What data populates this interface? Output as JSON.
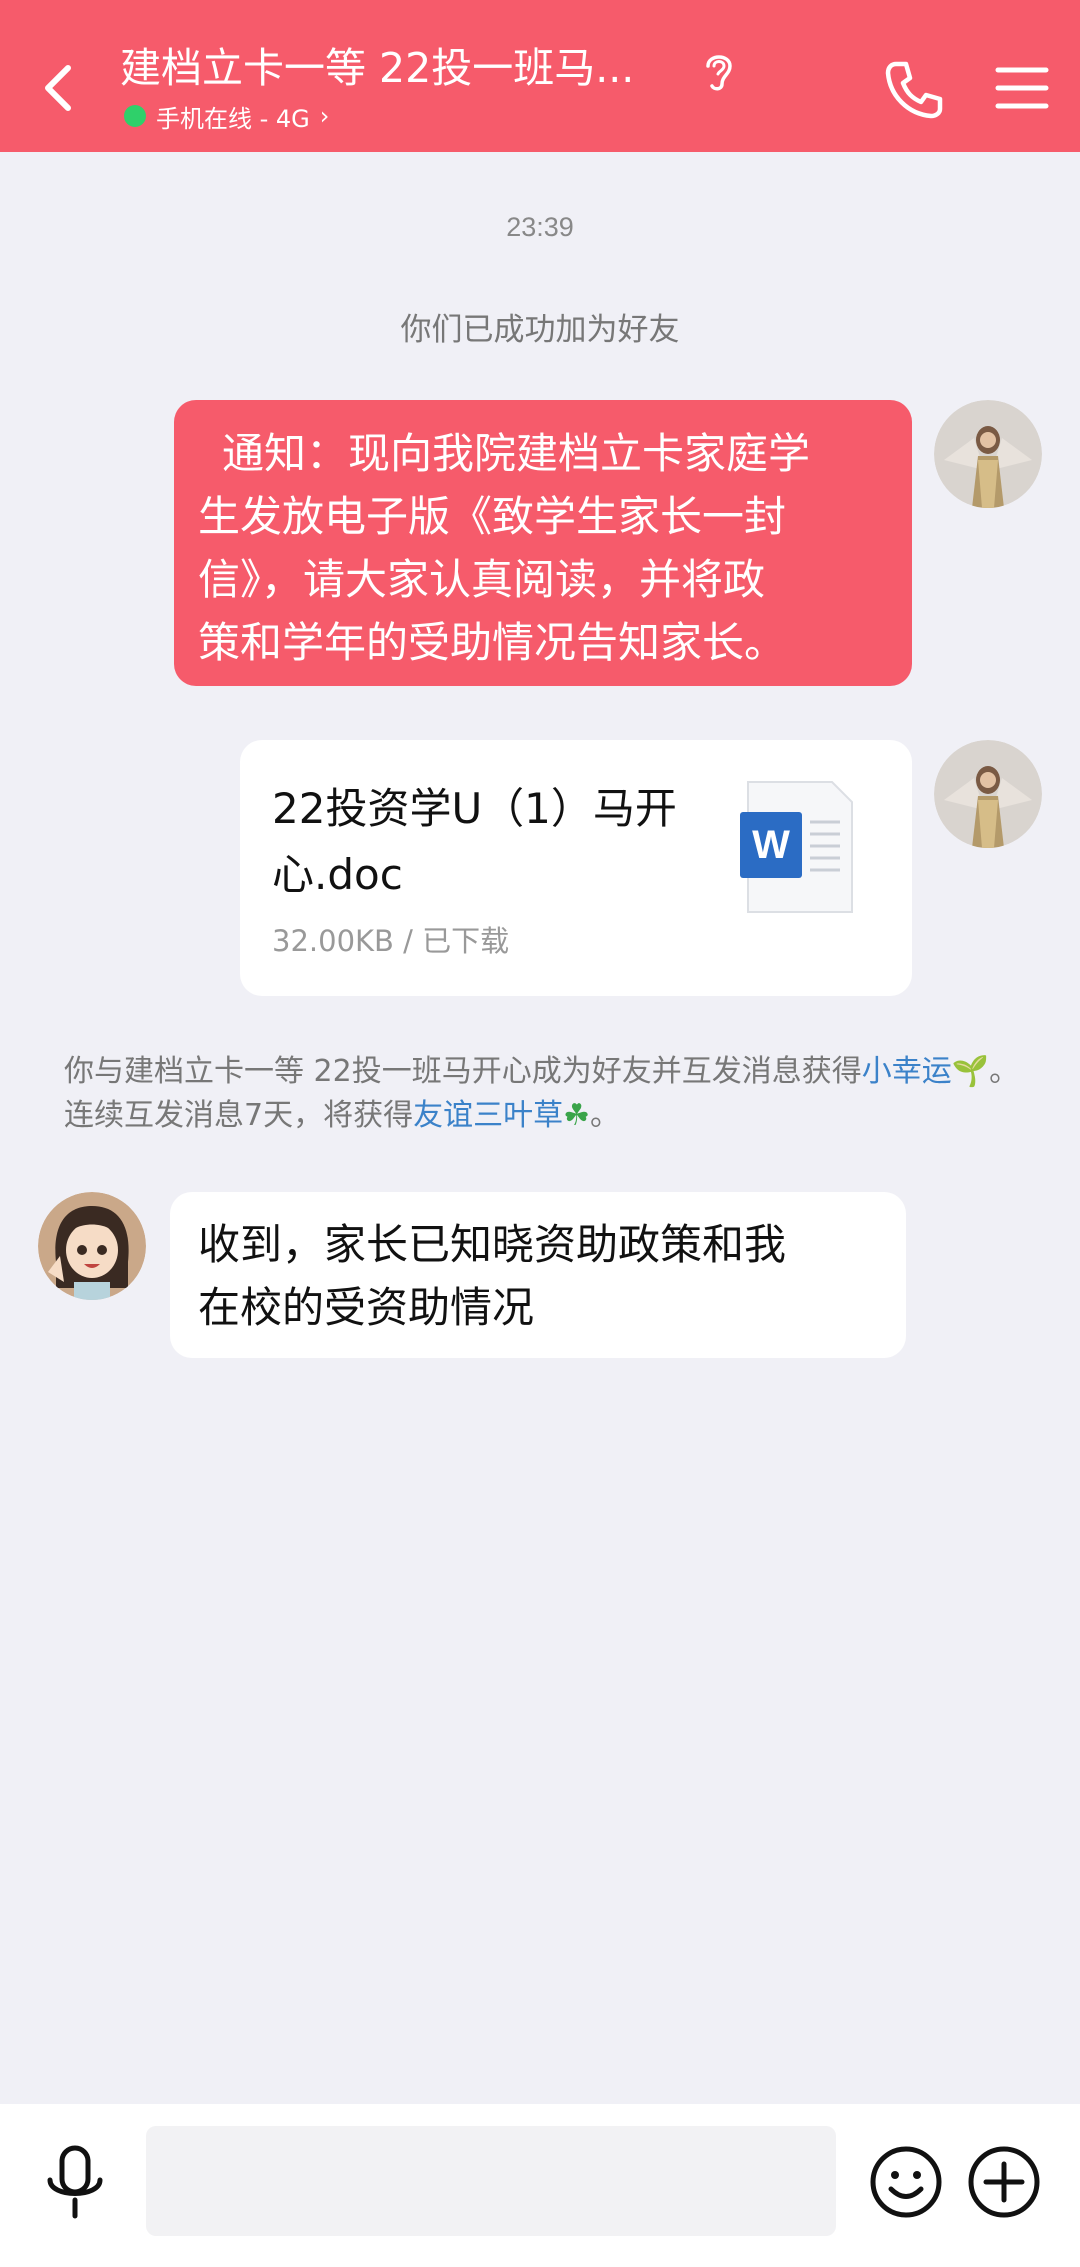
{
  "header": {
    "title": "建档立卡一等 22投一班马...",
    "status": "手机在线 - 4G",
    "status_chevron": "›",
    "background": "#f65b6b",
    "online_color": "#2fd06a"
  },
  "chat": {
    "time": "23:39",
    "system_friend_added": "你们已成功加为好友",
    "notice_message": {
      "lines": [
        "通知：现向我院建档立卡家庭学",
        "生发放电子版《致学生家长一封",
        "信》，请大家认真阅读，并将政",
        "策和学年的受助情况告知家长。"
      ],
      "bubble_color": "#f65b6b"
    },
    "file_message": {
      "name_lines": [
        "22投资学U（1）马开",
        "心.doc"
      ],
      "meta": "32.00KB / 已下载",
      "icon": "word-document-icon",
      "icon_letter": "W"
    },
    "luck_notice": {
      "part1": "你与建档立卡一等 22投一班马开心成为好友并互发消息获得",
      "link1": "小幸运",
      "emoji1": "🌱",
      "part2": "。连续互发消息7天，将获得",
      "link2": "友谊三叶草",
      "emoji2": "☘",
      "part3": "。",
      "link_color": "#3b82c9"
    },
    "reply_message": {
      "lines": [
        "收到，家长已知晓资助政策和我",
        "在校的受资助情况"
      ]
    }
  },
  "input_bar": {
    "placeholder": "",
    "icons": [
      "microphone-icon",
      "emoji-icon",
      "plus-icon"
    ]
  }
}
